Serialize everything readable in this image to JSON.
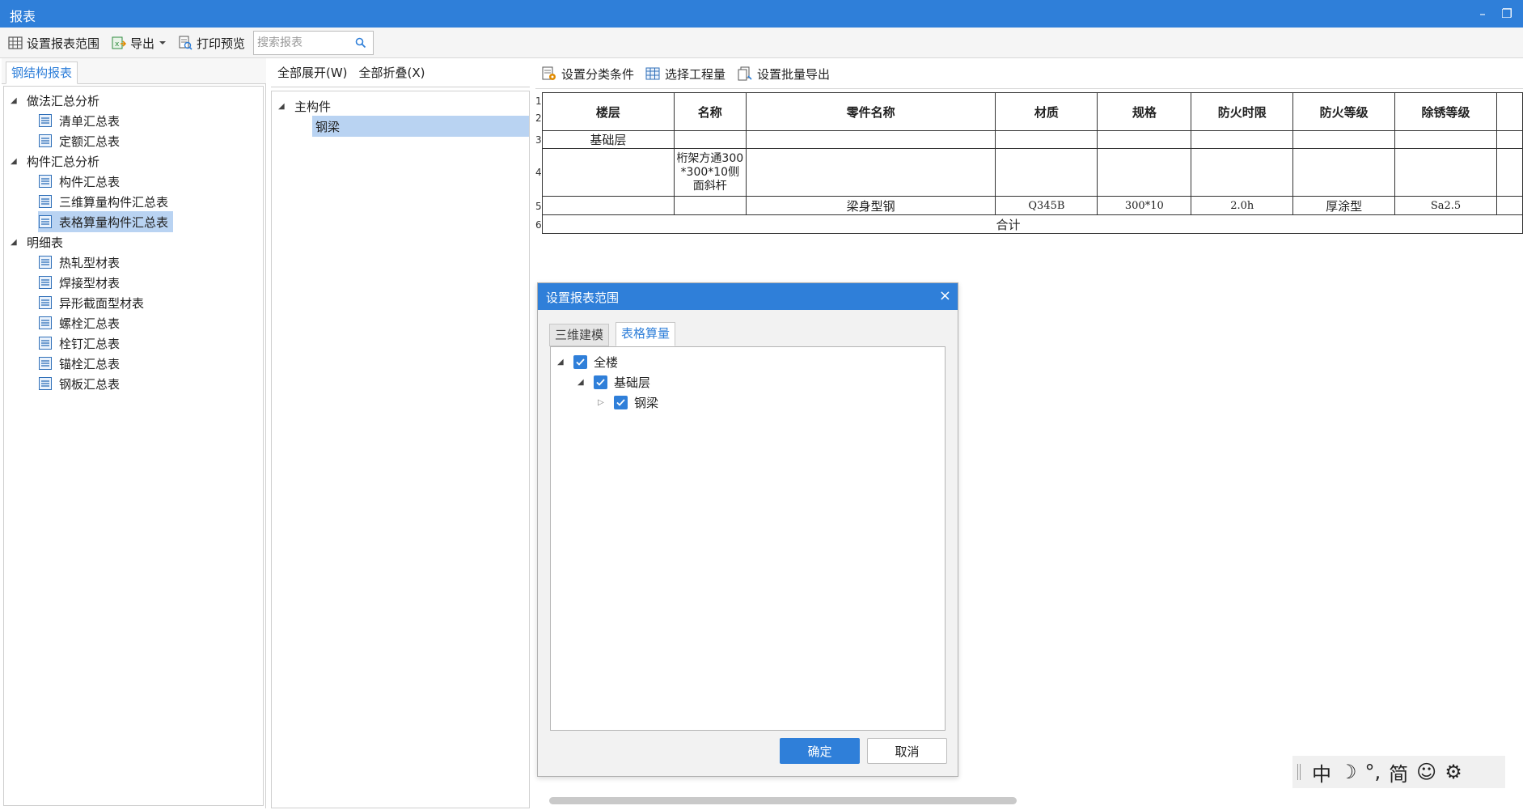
{
  "window": {
    "title": "报表",
    "minimize_label": "–",
    "restore_label": "❐"
  },
  "toolbar": {
    "set_range_label": "设置报表范围",
    "export_label": "导出",
    "print_preview_label": "打印预览",
    "search_placeholder": "搜索报表"
  },
  "left_panel": {
    "tab_label": "钢结构报表",
    "groups": [
      {
        "label": "做法汇总分析",
        "items": [
          "清单汇总表",
          "定额汇总表"
        ]
      },
      {
        "label": "构件汇总分析",
        "items": [
          "构件汇总表",
          "三维算量构件汇总表",
          "表格算量构件汇总表"
        ]
      },
      {
        "label": "明细表",
        "items": [
          "热轧型材表",
          "焊接型材表",
          "异形截面型材表",
          "螺栓汇总表",
          "栓钉汇总表",
          "锚栓汇总表",
          "钢板汇总表"
        ]
      }
    ],
    "selected_item": "表格算量构件汇总表"
  },
  "middle_panel": {
    "expand_all_label": "全部展开(W)",
    "collapse_all_label": "全部折叠(X)",
    "tree_root": "主构件",
    "tree_child": "钢梁"
  },
  "right_panel": {
    "set_category_label": "设置分类条件",
    "select_quantity_label": "选择工程量",
    "batch_export_label": "设置批量导出"
  },
  "report": {
    "row_numbers": [
      "1",
      "2",
      "3",
      "4",
      "5",
      "6"
    ],
    "headers": [
      "楼层",
      "名称",
      "零件名称",
      "材质",
      "规格",
      "防火时限",
      "防火等级",
      "除锈等级"
    ],
    "row3": {
      "floor": "基础层"
    },
    "row4": {
      "name": "桁架方通300*300*10侧面斜杆"
    },
    "row5": {
      "part": "梁身型钢",
      "material": "Q345B",
      "spec": "300*10",
      "fire_time": "2.0h",
      "fire_grade": "厚涂型",
      "rust_grade": "Sa2.5"
    },
    "row6": {
      "total": "合计"
    }
  },
  "dialog": {
    "title": "设置报表范围",
    "close_label": "×",
    "tabs": [
      "三维建模",
      "表格算量"
    ],
    "active_tab": "表格算量",
    "tree": {
      "root": "全楼",
      "floor": "基础层",
      "member": "钢梁"
    },
    "ok_label": "确定",
    "cancel_label": "取消"
  },
  "ime": {
    "mode": "中",
    "moon": "☽",
    "punct": "°,",
    "simplified": "简",
    "emoji": "☺",
    "settings": "⚙"
  },
  "colors": {
    "accent": "#2f7fd9",
    "selection": "#b9d3f2"
  }
}
